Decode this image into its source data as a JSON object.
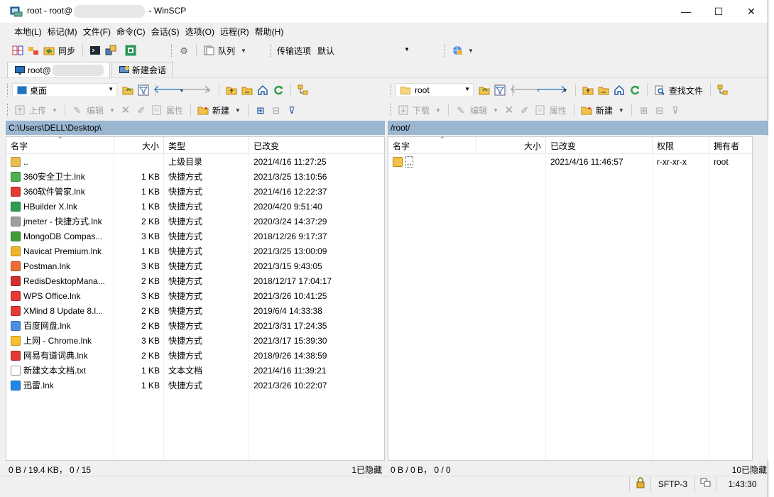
{
  "window": {
    "title_prefix": "root - root@",
    "title_suffix": " - WinSCP",
    "minimize": "—",
    "maximize": "☐",
    "close": "✕"
  },
  "menu": [
    "本地(L)",
    "标记(M)",
    "文件(F)",
    "命令(C)",
    "会话(S)",
    "选项(O)",
    "远程(R)",
    "帮助(H)"
  ],
  "toolbar": {
    "sync_label": "同步",
    "queue_label": "队列",
    "transfer_label": "传输选项",
    "transfer_value": "默认"
  },
  "tabs": {
    "session_label": "root@",
    "new_session_label": "新建会话"
  },
  "local": {
    "location": "桌面",
    "upload_label": "上传",
    "edit_label": "编辑",
    "properties_label": "属性",
    "new_label": "新建",
    "path": "C:\\Users\\DELL\\Desktop\\",
    "columns": [
      "名字",
      "大小",
      "类型",
      "已改变"
    ],
    "files": [
      {
        "name": "..",
        "size": "",
        "type": "上级目录",
        "modified": "2021/4/16   11:27:25",
        "icon": "parent-dir",
        "color": "#e8c050"
      },
      {
        "name": "360安全卫士.lnk",
        "size": "1 KB",
        "type": "快捷方式",
        "modified": "2021/3/25   13:10:56",
        "icon": "360-icon",
        "color": "#4caf50"
      },
      {
        "name": "360软件管家.lnk",
        "size": "1 KB",
        "type": "快捷方式",
        "modified": "2021/4/16   12:22:37",
        "icon": "360soft-icon",
        "color": "#e53935"
      },
      {
        "name": "HBuilder X.lnk",
        "size": "1 KB",
        "type": "快捷方式",
        "modified": "2020/4/20   9:51:40",
        "icon": "hbuilder-icon",
        "color": "#2e9e4f"
      },
      {
        "name": "jmeter - 快捷方式.lnk",
        "size": "2 KB",
        "type": "快捷方式",
        "modified": "2020/3/24   14:37:29",
        "icon": "jmeter-icon",
        "color": "#9e9e9e"
      },
      {
        "name": "MongoDB Compas...",
        "size": "3 KB",
        "type": "快捷方式",
        "modified": "2018/12/26   9:17:37",
        "icon": "mongodb-icon",
        "color": "#3f9c35"
      },
      {
        "name": "Navicat Premium.lnk",
        "size": "1 KB",
        "type": "快捷方式",
        "modified": "2021/3/25   13:00:09",
        "icon": "navicat-icon",
        "color": "#f0b429"
      },
      {
        "name": "Postman.lnk",
        "size": "3 KB",
        "type": "快捷方式",
        "modified": "2021/3/15   9:43:05",
        "icon": "postman-icon",
        "color": "#ef6c35"
      },
      {
        "name": "RedisDesktopMana...",
        "size": "2 KB",
        "type": "快捷方式",
        "modified": "2018/12/17   17:04:17",
        "icon": "redis-icon",
        "color": "#d32f2f"
      },
      {
        "name": "WPS Office.lnk",
        "size": "3 KB",
        "type": "快捷方式",
        "modified": "2021/3/26   10:41:25",
        "icon": "wps-icon",
        "color": "#e53935"
      },
      {
        "name": "XMind 8 Update 8.l...",
        "size": "2 KB",
        "type": "快捷方式",
        "modified": "2019/6/4   14:33:38",
        "icon": "xmind-icon",
        "color": "#e53935"
      },
      {
        "name": "百度网盘.lnk",
        "size": "2 KB",
        "type": "快捷方式",
        "modified": "2021/3/31   17:24:35",
        "icon": "baidu-icon",
        "color": "#4a90e2"
      },
      {
        "name": "上网 - Chrome.lnk",
        "size": "3 KB",
        "type": "快捷方式",
        "modified": "2021/3/17   15:39:30",
        "icon": "chrome-icon",
        "color": "#fbc02d"
      },
      {
        "name": "网易有道词典.lnk",
        "size": "2 KB",
        "type": "快捷方式",
        "modified": "2018/9/26   14:38:59",
        "icon": "youdao-icon",
        "color": "#e53935"
      },
      {
        "name": "新建文本文档.txt",
        "size": "1 KB",
        "type": "文本文档",
        "modified": "2021/4/16   11:39:21",
        "icon": "text-file-icon",
        "color": "#ffffff"
      },
      {
        "name": "迅雷.lnk",
        "size": "1 KB",
        "type": "快捷方式",
        "modified": "2021/3/26   10:22:07",
        "icon": "xunlei-icon",
        "color": "#1e88e5"
      }
    ],
    "status_left": "0 B / 19.4 KB，  0 / 15",
    "status_right": "1已隐藏"
  },
  "remote": {
    "location": "root",
    "download_label": "下载",
    "edit_label": "编辑",
    "properties_label": "属性",
    "new_label": "新建",
    "find_label": "查找文件",
    "path": "/root/",
    "columns": [
      "名字",
      "大小",
      "已改变",
      "权限",
      "拥有者"
    ],
    "files": [
      {
        "name": "..",
        "size": "",
        "modified": "2021/4/16 11:46:57",
        "rights": "r-xr-xr-x",
        "owner": "root"
      }
    ],
    "status_left": "0 B / 0 B，  0 / 0",
    "status_right": "10已隐藏"
  },
  "statusbar": {
    "protocol": "SFTP-3",
    "time": "1:43:30"
  }
}
